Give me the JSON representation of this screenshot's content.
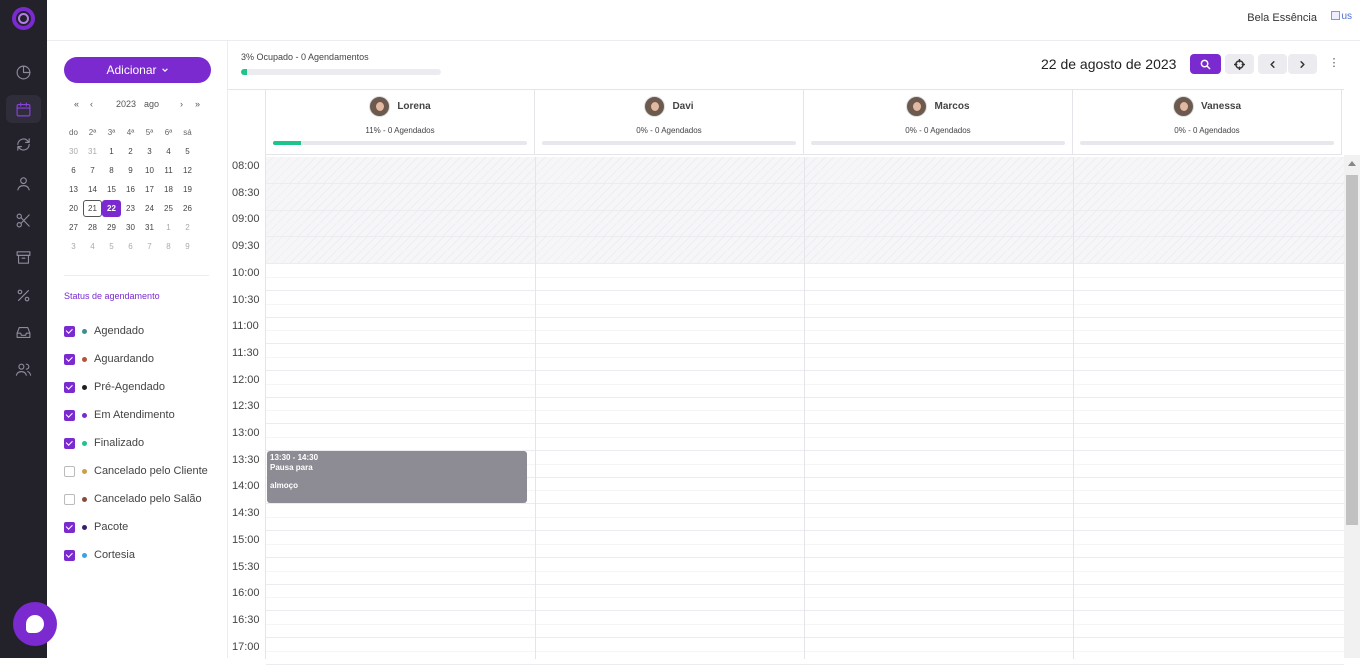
{
  "app": {
    "salon_name": "Bela Essência",
    "avatar_alt": "us",
    "brand_color": "#7b2ad0"
  },
  "rail": {
    "icons": [
      "logo-icon",
      "dashboard-icon",
      "calendar-icon",
      "sync-icon",
      "user-icon",
      "scissors-icon",
      "archive-icon",
      "percent-icon",
      "inbox-icon",
      "users-icon"
    ]
  },
  "sidebar": {
    "add_label": "Adicionar",
    "calendar": {
      "year": "2023",
      "month": "ago",
      "weekdays": [
        "do",
        "2ª",
        "3ª",
        "4ª",
        "5ª",
        "6ª",
        "sá"
      ],
      "weeks": [
        [
          "30",
          "31",
          "1",
          "2",
          "3",
          "4",
          "5"
        ],
        [
          "6",
          "7",
          "8",
          "9",
          "10",
          "11",
          "12"
        ],
        [
          "13",
          "14",
          "15",
          "16",
          "17",
          "18",
          "19"
        ],
        [
          "20",
          "21",
          "22",
          "23",
          "24",
          "25",
          "26"
        ],
        [
          "27",
          "28",
          "29",
          "30",
          "31",
          "1",
          "2"
        ],
        [
          "3",
          "4",
          "5",
          "6",
          "7",
          "8",
          "9"
        ]
      ]
    },
    "status_title": "Status de agendamento",
    "statuses": [
      {
        "label": "Agendado",
        "checked": true,
        "color": "#3f8f8f"
      },
      {
        "label": "Aguardando",
        "checked": true,
        "color": "#b5533a"
      },
      {
        "label": "Pré-Agendado",
        "checked": true,
        "color": "#1f1f1f"
      },
      {
        "label": "Em Atendimento",
        "checked": true,
        "color": "#7b2ad0"
      },
      {
        "label": "Finalizado",
        "checked": true,
        "color": "#1ec48a"
      },
      {
        "label": "Cancelado pelo Cliente",
        "checked": false,
        "color": "#c9a04a"
      },
      {
        "label": "Cancelado pelo Salão",
        "checked": false,
        "color": "#8a4a3a"
      },
      {
        "label": "Pacote",
        "checked": true,
        "color": "#3a1f6a"
      },
      {
        "label": "Cortesia",
        "checked": true,
        "color": "#3aa3e0"
      }
    ]
  },
  "main": {
    "occupancy_text": "3% Ocupado - 0 Agendamentos",
    "occupancy_percent": 3,
    "date_title": "22 de agosto de 2023",
    "professionals": [
      {
        "name": "Lorena",
        "stats": "11% - 0 Agendados",
        "percent": 11
      },
      {
        "name": "Davi",
        "stats": "0% - 0 Agendados",
        "percent": 0
      },
      {
        "name": "Marcos",
        "stats": "0% - 0 Agendados",
        "percent": 0
      },
      {
        "name": "Vanessa",
        "stats": "0% - 0 Agendados",
        "percent": 0
      }
    ],
    "times": [
      "08:00",
      "08:30",
      "09:00",
      "09:30",
      "10:00",
      "10:30",
      "11:00",
      "11:30",
      "12:00",
      "12:30",
      "13:00",
      "13:30",
      "14:00",
      "14:30",
      "15:00",
      "15:30",
      "16:00",
      "16:30",
      "17:00"
    ],
    "event": {
      "time": "13:30 - 14:30",
      "title_line1": "Pausa para",
      "title_line2": "almoço"
    }
  }
}
